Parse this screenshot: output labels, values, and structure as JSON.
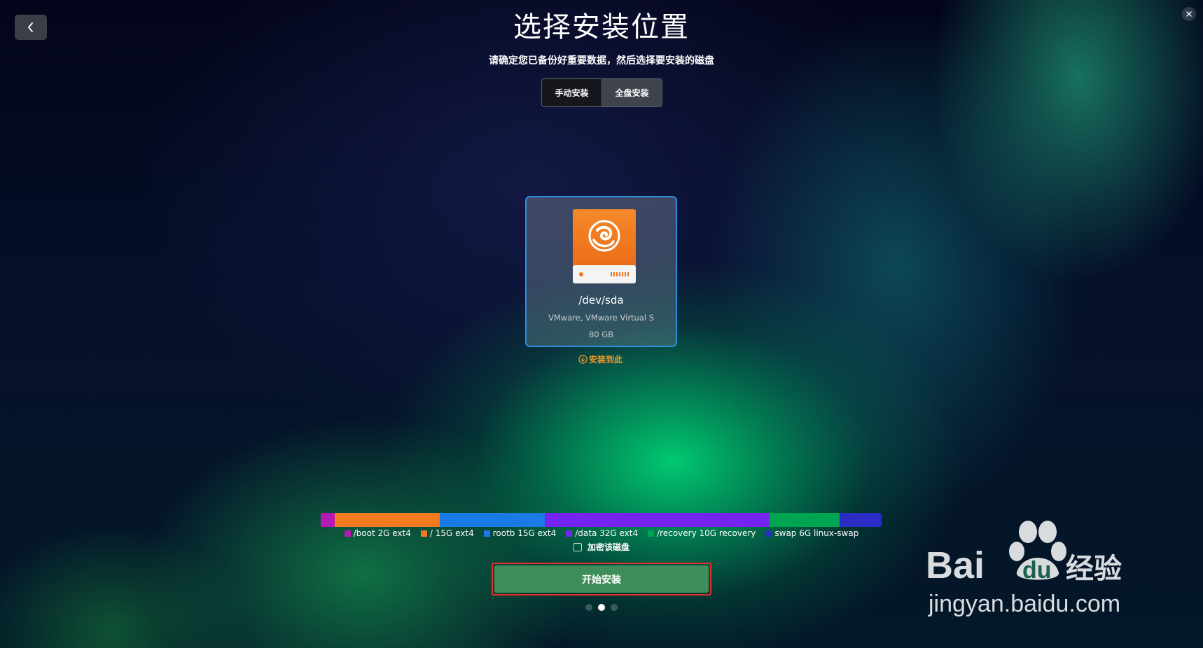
{
  "header": {
    "title": "选择安装位置",
    "subtitle": "请确定您已备份好重要数据，然后选择要安装的磁盘"
  },
  "mode_tabs": [
    {
      "label": "手动安装",
      "active": false
    },
    {
      "label": "全盘安装",
      "active": true
    }
  ],
  "disk": {
    "name": "/dev/sda",
    "model": "VMware, VMware Virtual S",
    "size": "80 GB",
    "install_here_label": "安装到此",
    "icon": "deepin-disk-icon"
  },
  "partitions": [
    {
      "label": "/boot 2G ext4",
      "size_gb": 2,
      "color": "#b51ab5"
    },
    {
      "label": "/ 15G ext4",
      "size_gb": 15,
      "color": "#f07b20"
    },
    {
      "label": "rootb 15G ext4",
      "size_gb": 15,
      "color": "#1a7be8"
    },
    {
      "label": "/data 32G ext4",
      "size_gb": 32,
      "color": "#7424ee"
    },
    {
      "label": "/recovery 10G recovery",
      "size_gb": 10,
      "color": "#00a64f"
    },
    {
      "label": "swap 6G linux-swap",
      "size_gb": 6,
      "color": "#2a2cc4"
    }
  ],
  "encrypt": {
    "label": "加密该磁盘",
    "checked": false
  },
  "start_button_label": "开始安装",
  "pager": {
    "total": 3,
    "current": 2
  },
  "watermark": {
    "brand_text": "Bai",
    "brand_text_2": "du",
    "brand_cn": "经验",
    "url": "jingyan.baidu.com"
  }
}
